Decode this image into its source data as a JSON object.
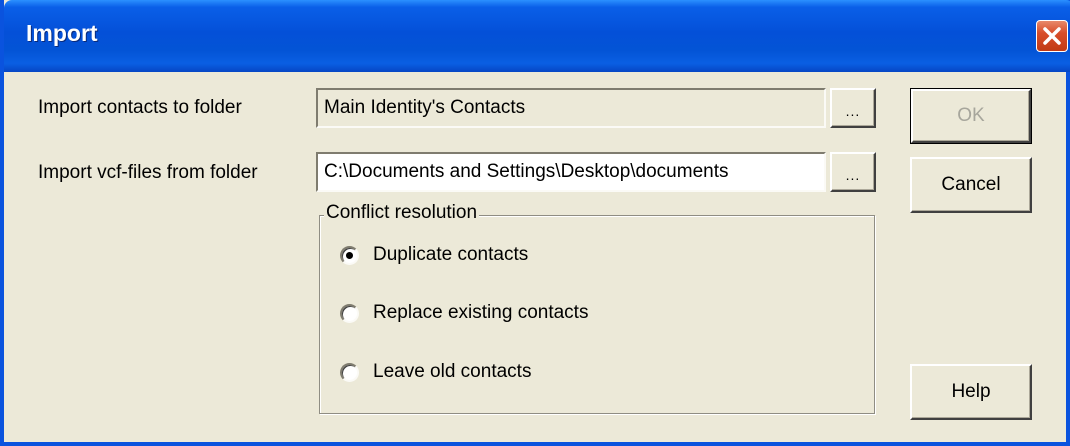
{
  "window": {
    "title": "Import"
  },
  "form": {
    "folder_label": "Import contacts to folder",
    "folder_value": "Main Identity's Contacts",
    "vcf_label": "Import vcf-files from folder",
    "vcf_value": "C:\\Documents and Settings\\Desktop\\documents",
    "browse_label": "..."
  },
  "conflict": {
    "legend": "Conflict resolution",
    "options": [
      {
        "label": "Duplicate contacts",
        "selected": true
      },
      {
        "label": "Replace existing contacts",
        "selected": false
      },
      {
        "label": "Leave old contacts",
        "selected": false
      }
    ]
  },
  "buttons": {
    "ok": "OK",
    "cancel": "Cancel",
    "help": "Help"
  },
  "colors": {
    "titlebar": "#0354d6",
    "dialog_bg": "#ece9d8",
    "close": "#d84e2a"
  },
  "icons": {
    "close": "close-icon"
  }
}
